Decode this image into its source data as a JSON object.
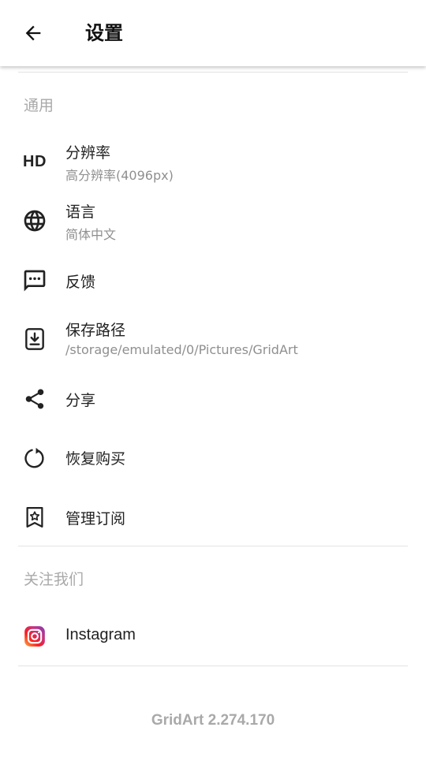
{
  "header": {
    "title": "设置",
    "back_icon": "arrow-back-icon"
  },
  "sections": {
    "general": {
      "label": "通用",
      "items": [
        {
          "key": "resolution",
          "icon": "hd-icon",
          "icon_text": "HD",
          "title": "分辨率",
          "subtitle": "高分辨率(4096px)"
        },
        {
          "key": "language",
          "icon": "globe-icon",
          "title": "语言",
          "subtitle": "简体中文"
        },
        {
          "key": "feedback",
          "icon": "chat-bubble-icon",
          "title": "反馈"
        },
        {
          "key": "save_path",
          "icon": "download-icon",
          "title": "保存路径",
          "subtitle": "/storage/emulated/0/Pictures/GridArt"
        },
        {
          "key": "share",
          "icon": "share-icon",
          "title": "分享"
        },
        {
          "key": "restore",
          "icon": "restore-icon",
          "title": "恢复购买"
        },
        {
          "key": "subscription",
          "icon": "bookmark-star-icon",
          "title": "管理订阅"
        }
      ]
    },
    "follow": {
      "label": "关注我们",
      "items": [
        {
          "key": "instagram",
          "icon": "instagram-icon",
          "title": "Instagram"
        }
      ]
    }
  },
  "footer": {
    "version": "GridArt 2.274.170"
  },
  "colors": {
    "text_primary": "#222222",
    "text_secondary": "#8f8f8f",
    "section_label": "#a9a9a9",
    "divider": "#e3e3e3"
  }
}
